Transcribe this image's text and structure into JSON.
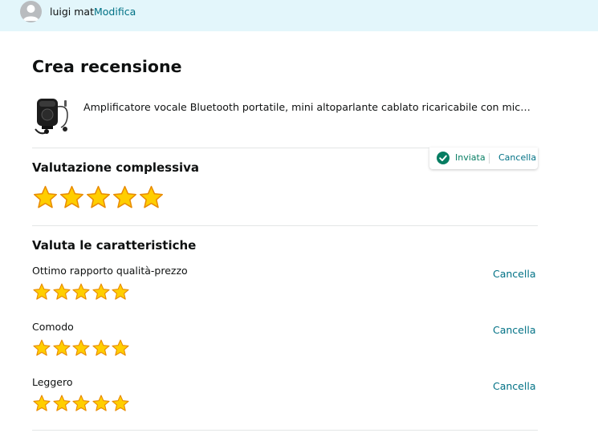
{
  "header": {
    "username": "luigi mat",
    "edit_label": "Modifica"
  },
  "page": {
    "title": "Crea recensione"
  },
  "product": {
    "title": "Amplificatore vocale Bluetooth portatile, mini altoparlante cablato ricaricabile con microfono, p..."
  },
  "overall": {
    "heading": "Valutazione complessiva",
    "rating": 5,
    "max_rating": 5,
    "status_label": "Inviata",
    "cancel_label": "Cancella"
  },
  "features": {
    "heading": "Valuta le caratteristiche",
    "items": [
      {
        "label": "Ottimo rapporto qualità-prezzo",
        "rating": 5,
        "cancel_label": "Cancella"
      },
      {
        "label": "Comodo",
        "rating": 5,
        "cancel_label": "Cancella"
      },
      {
        "label": "Leggero",
        "rating": 5,
        "cancel_label": "Cancella"
      }
    ]
  },
  "colors": {
    "header_bg": "#e3f6fb",
    "link": "#007185",
    "success": "#067d62",
    "star_fill": "#ffce00",
    "star_outline": "#e88b01"
  }
}
